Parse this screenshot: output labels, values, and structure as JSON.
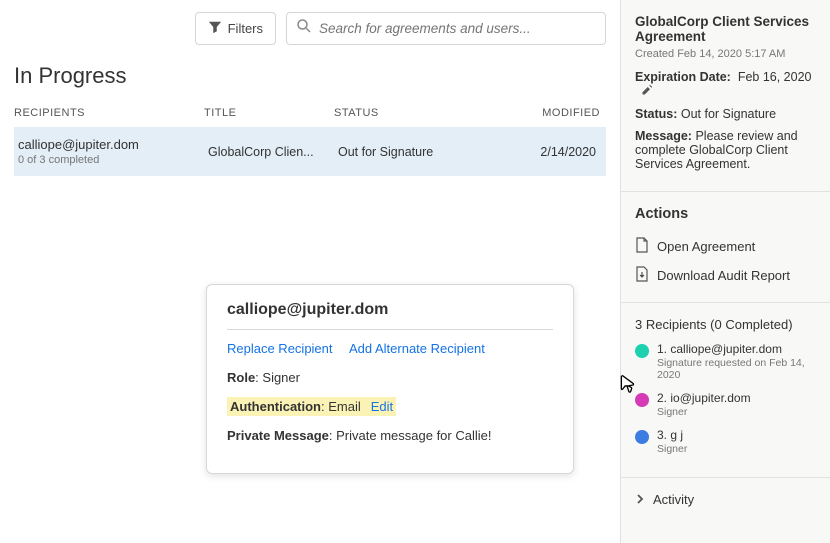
{
  "filters_label": "Filters",
  "search": {
    "placeholder": "Search for agreements and users..."
  },
  "page_title": "In Progress",
  "columns": {
    "r": "RECIPIENTS",
    "t": "TITLE",
    "s": "STATUS",
    "m": "MODIFIED"
  },
  "row": {
    "email": "calliope@jupiter.dom",
    "completed": "0 of 3 completed",
    "title": "GlobalCorp Clien...",
    "status": "Out for Signature",
    "modified": "2/14/2020"
  },
  "popover": {
    "title": "calliope@jupiter.dom",
    "replace": "Replace Recipient",
    "alt": "Add Alternate Recipient",
    "role_label": "Role",
    "role_value": ": Signer",
    "auth_label": "Authentication",
    "auth_value": ": Email",
    "edit": "Edit",
    "pm_label": "Private Message",
    "pm_value": ": Private message for Callie!"
  },
  "sidebar": {
    "title": "GlobalCorp Client Services Agreement",
    "created": "Created Feb 14, 2020 5:17 AM",
    "exp_label": "Expiration Date:",
    "exp_value": "Feb 16, 2020",
    "status_label": "Status:",
    "status_value": "Out for Signature",
    "msg_label": "Message:",
    "msg_value": "Please review and complete GlobalCorp Client Services Agreement.",
    "actions_title": "Actions",
    "open": "Open Agreement",
    "download": "Download Audit Report",
    "recips_head": "3 Recipients (0 Completed)",
    "r1": {
      "ord": "1.",
      "email": "calliope@jupiter.dom",
      "sub": "Signature requested on Feb 14, 2020",
      "color": "#1cd0b0"
    },
    "r2": {
      "ord": "2.",
      "email": "io@jupiter.dom",
      "sub": "Signer",
      "color": "#d63ab4"
    },
    "r3": {
      "ord": "3.",
      "email": "g j",
      "sub": "Signer",
      "color": "#3b7de0"
    },
    "activity": "Activity"
  }
}
